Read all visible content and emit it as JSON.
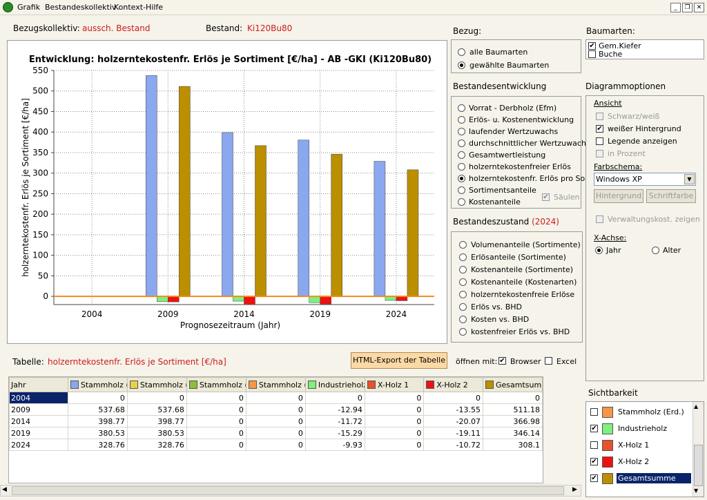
{
  "menu": {
    "items": [
      "Grafik",
      "Bestandeskollektiv",
      "Kontext-Hilfe"
    ]
  },
  "window_buttons": {
    "minimize": "_",
    "restore": "❐",
    "close": "✕"
  },
  "header": {
    "bezugskollektiv_label": "Bezugskollektiv:",
    "bezugskollektiv_value": "aussch. Bestand",
    "bestand_label": "Bestand:",
    "bestand_value": "Ki120Bu80"
  },
  "bezug": {
    "title": "Bezug:",
    "options": [
      {
        "label": "alle Baumarten",
        "selected": false
      },
      {
        "label": "gewählte Baumarten",
        "selected": true
      }
    ]
  },
  "baumarten": {
    "title": "Baumarten:",
    "items": [
      {
        "label": "Gem.Kiefer",
        "checked": true
      },
      {
        "label": "Buche",
        "checked": false
      }
    ]
  },
  "bestandesentwicklung": {
    "title": "Bestandesentwicklung",
    "options": [
      {
        "label": "Vorrat - Derbholz (Efm)",
        "selected": false
      },
      {
        "label": "Erlös- u. Kostenentwicklung",
        "selected": false
      },
      {
        "label": "laufender Wertzuwachs",
        "selected": false
      },
      {
        "label": "durchschnittlicher Wertzuwachs",
        "selected": false
      },
      {
        "label": "Gesamtwertleistung",
        "selected": false
      },
      {
        "label": "holzerntekostenfreier Erlös",
        "selected": false
      },
      {
        "label": "holzerntekostenfr. Erlös pro Sort.",
        "selected": true
      },
      {
        "label": "Sortimentsanteile",
        "selected": false
      },
      {
        "label": "Kostenanteile",
        "selected": false
      }
    ],
    "saeulen_label": "Säulen",
    "saeulen_checked": true
  },
  "bestandeszustand": {
    "title": "Bestandeszustand",
    "year": "(2024)",
    "options": [
      {
        "label": "Volumenanteile (Sortimente)",
        "selected": false
      },
      {
        "label": "Erlösanteile (Sortimente)",
        "selected": false
      },
      {
        "label": "Kostenanteile (Sortimente)",
        "selected": false
      },
      {
        "label": "Kostenanteile (Kostenarten)",
        "selected": false
      },
      {
        "label": "holzerntekostenfreie Erlöse",
        "selected": false
      },
      {
        "label": "Erlös vs. BHD",
        "selected": false
      },
      {
        "label": "Kosten vs. BHD",
        "selected": false
      },
      {
        "label": "kostenfreier Erlös vs. BHD",
        "selected": false
      }
    ]
  },
  "diagrammoptionen": {
    "title": "Diagrammoptionen",
    "ansicht_label": "Ansicht",
    "ansicht": [
      {
        "label": "Schwarz/weiß",
        "checked": false,
        "disabled": true
      },
      {
        "label": "weißer Hintergrund",
        "checked": true,
        "disabled": false
      },
      {
        "label": "Legende anzeigen",
        "checked": false,
        "disabled": false
      },
      {
        "label": "in Prozent",
        "checked": false,
        "disabled": true
      }
    ],
    "farbschema_label": "Farbschema:",
    "farbschema_value": "Windows XP",
    "hintergrund_button": "Hintergrund",
    "schriftfarbe_button": "Schriftfarbe",
    "verwaltung_label": "Verwaltungskost. zeigen",
    "xachse_label": "X-Achse:",
    "xachse_options": [
      {
        "label": "Jahr",
        "selected": true
      },
      {
        "label": "Alter",
        "selected": false
      }
    ]
  },
  "sichtbarkeit": {
    "title": "Sichtbarkeit",
    "items": [
      {
        "label": "Stammholz (Erd.)",
        "checked": false,
        "color": "#f79646",
        "selected": false
      },
      {
        "label": "Industrieholz",
        "checked": true,
        "color": "#7ef07e",
        "selected": false
      },
      {
        "label": "X-Holz 1",
        "checked": false,
        "color": "#e8512b",
        "selected": false
      },
      {
        "label": "X-Holz 2",
        "checked": true,
        "color": "#ee1111",
        "selected": false
      },
      {
        "label": "Gesamtsumme",
        "checked": true,
        "color": "#bb8f00",
        "selected": true
      }
    ]
  },
  "tabelle": {
    "label": "Tabelle:",
    "title": "holzerntekostenfr. Erlös je Sortiment [€/ha]",
    "export_button": "HTML-Export der Tabelle",
    "oeffnen_label": "öffnen mit:",
    "browser_label": "Browser",
    "browser_checked": true,
    "excel_label": "Excel",
    "excel_checked": false,
    "year_header": "Jahr",
    "columns": [
      {
        "label": "Stammholz (Gesamt)",
        "color": "#8aa8ef"
      },
      {
        "label": "Stammholz (lang)",
        "color": "#ebd047"
      },
      {
        "label": "Stammholz (Ab)",
        "color": "#8cbd3b"
      },
      {
        "label": "Stammholz (Erd.)",
        "color": "#f79646"
      },
      {
        "label": "Industrieholz",
        "color": "#7ef07e"
      },
      {
        "label": "X-Holz 1",
        "color": "#e8512b"
      },
      {
        "label": "X-Holz 2",
        "color": "#ee1111"
      },
      {
        "label": "Gesamtsumme",
        "color": "#bb8f00"
      }
    ],
    "rows": [
      {
        "year": "2004",
        "values": [
          "0",
          "0",
          "0",
          "0",
          "0",
          "0",
          "0",
          "0"
        ]
      },
      {
        "year": "2009",
        "values": [
          "537.68",
          "537.68",
          "0",
          "0",
          "-12.94",
          "0",
          "-13.55",
          "511.18"
        ]
      },
      {
        "year": "2014",
        "values": [
          "398.77",
          "398.77",
          "0",
          "0",
          "-11.72",
          "0",
          "-20.07",
          "366.98"
        ]
      },
      {
        "year": "2019",
        "values": [
          "380.53",
          "380.53",
          "0",
          "0",
          "-15.29",
          "0",
          "-19.11",
          "346.14"
        ]
      },
      {
        "year": "2024",
        "values": [
          "328.76",
          "328.76",
          "0",
          "0",
          "-9.93",
          "0",
          "-10.72",
          "308.1"
        ]
      }
    ]
  },
  "chart_data": {
    "type": "bar",
    "title": "Entwicklung: holzerntekostenfr. Erlös je Sortiment [€/ha] - AB -GKI (Ki120Bu80)",
    "xlabel": "Prognosezeitraum (Jahr)",
    "ylabel": "holzerntekostenfr. Erlös je Sortiment [€/ha]",
    "categories": [
      "2004",
      "2009",
      "2014",
      "2019",
      "2024"
    ],
    "ylim": [
      -20,
      550
    ],
    "yticks": [
      0,
      50,
      100,
      150,
      200,
      250,
      300,
      350,
      400,
      450,
      500,
      550
    ],
    "grid": true,
    "series": [
      {
        "name": "Stammholz (Gesamt)",
        "color": "#8aa8ef",
        "values": [
          0,
          537.68,
          398.77,
          380.53,
          328.76
        ]
      },
      {
        "name": "Industrieholz",
        "color": "#7ef07e",
        "values": [
          0,
          -12.94,
          -11.72,
          -15.29,
          -9.93
        ]
      },
      {
        "name": "X-Holz 2",
        "color": "#ee1111",
        "values": [
          0,
          -13.55,
          -20.07,
          -19.11,
          -10.72
        ]
      },
      {
        "name": "Gesamtsumme",
        "color": "#bb8f00",
        "values": [
          0,
          511.18,
          366.98,
          346.14,
          308.1
        ]
      }
    ]
  }
}
